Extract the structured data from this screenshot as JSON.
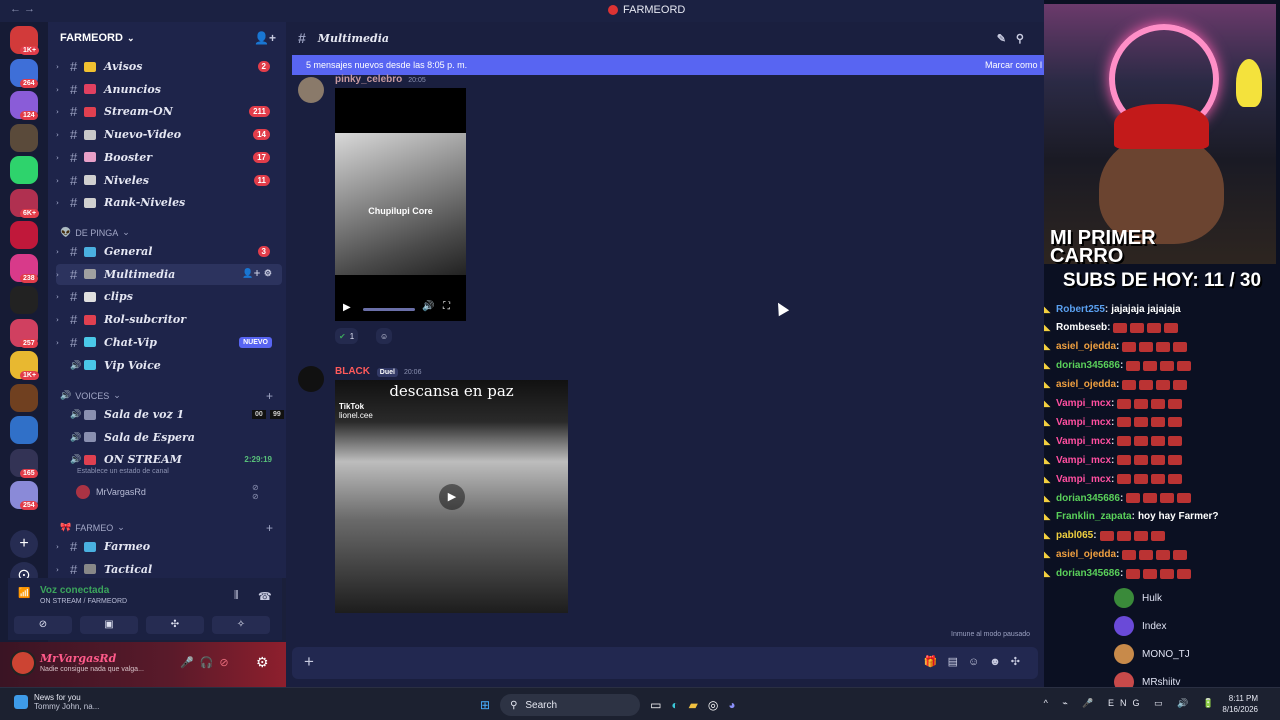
{
  "titlebar": {
    "app_name": "FARMEORD",
    "nav": "← →"
  },
  "rail": {
    "servers": [
      {
        "color": "#d23a3a",
        "badge": "1K+"
      },
      {
        "color": "#3e6fd8",
        "badge": "264"
      },
      {
        "color": "#8a5cd8",
        "badge": "124"
      },
      {
        "color": "#5a4a3a",
        "badge": ""
      },
      {
        "color": "#2ed36c",
        "badge": ""
      },
      {
        "color": "#b03050",
        "badge": "6K+"
      },
      {
        "color": "#c0183a",
        "badge": ""
      },
      {
        "color": "#d83a8a",
        "badge": "238"
      },
      {
        "color": "#222222",
        "badge": ""
      },
      {
        "color": "#d04060",
        "badge": "257"
      },
      {
        "color": "#e8b830",
        "badge": "1K+"
      },
      {
        "color": "#704020",
        "badge": ""
      },
      {
        "color": "#3070c8",
        "badge": ""
      },
      {
        "color": "#333355",
        "badge": "165"
      },
      {
        "color": "#8a8ad8",
        "badge": "254"
      }
    ]
  },
  "server": {
    "name": "FARMEORD",
    "caret": "⌄",
    "invite_icon": "person-add-icon"
  },
  "channels": {
    "top": [
      {
        "name": "Avisos",
        "count": "2",
        "emo": "#f0c030"
      },
      {
        "name": "Anuncios",
        "count": "",
        "emo": "#e04060"
      },
      {
        "name": "Stream-ON",
        "count": "211",
        "emo": "#e04050"
      },
      {
        "name": "Nuevo-Video",
        "count": "14",
        "emo": "#c8c8c8"
      },
      {
        "name": "Booster",
        "count": "17",
        "emo": "#e8a0c8"
      },
      {
        "name": "Niveles",
        "count": "11",
        "emo": "#d0d0d0"
      },
      {
        "name": "Rank-Niveles",
        "count": "",
        "emo": "#d0d0d0"
      }
    ],
    "cat_pinga": "DE PINGA",
    "pinga": [
      {
        "name": "General",
        "count": "3",
        "emo": "#4ab0e0"
      },
      {
        "name": "Multimedia",
        "count": "",
        "emo": "#a0a0a0"
      },
      {
        "name": "clips",
        "count": "",
        "emo": "#e0e0e0"
      },
      {
        "name": "Rol-subcritor",
        "count": "",
        "emo": "#e04050"
      },
      {
        "name": "Chat-Vip",
        "count": "",
        "emo": "#4ac8e8",
        "new": "NUEVO"
      },
      {
        "name": "Vip Voice",
        "count": "",
        "emo": "#4ac8e8"
      }
    ],
    "cat_voices": "VOICES",
    "voices": [
      {
        "name": "Sala de voz 1",
        "emo": "#8a90b0",
        "count_a": "00",
        "count_b": "99"
      },
      {
        "name": "Sala de Espera",
        "emo": "#8a90b0"
      },
      {
        "name": "ON STREAM",
        "emo": "#e04050",
        "timer": "2:29:19"
      }
    ],
    "voice_status": "Establece un estado de canal",
    "voice_user": "MrVargasRd",
    "cat_farmeo": "FARMEO",
    "farmeo": [
      {
        "name": "Farmeo",
        "emo": "#4ab0e0"
      },
      {
        "name": "Tactical",
        "emo": "#888888"
      }
    ]
  },
  "voicebar": {
    "title": "Voz conectada",
    "sub": "ON STREAM / FARMEORD",
    "buttons": [
      "camera-off-icon",
      "screen-share-icon",
      "activities-icon",
      "soundboard-icon"
    ]
  },
  "user": {
    "name": "MrVargasRd",
    "status": "Nadie consigue nada que valga..."
  },
  "chat": {
    "channel": "Multimedia",
    "new_messages": "5 mensajes nuevos desde las 8:05 p. m.",
    "mark_read": "Marcar como l",
    "msg1": {
      "author": "pinky_celebro",
      "time": "20:05",
      "caption": "Chupilupi Core",
      "reaction_count": "1"
    },
    "msg2": {
      "author": "BLACK",
      "tag": "Duel",
      "time": "20:06",
      "video_title": "descansa en paz",
      "tiktok": "TikTok",
      "tiktok_user": "lionel.cee"
    },
    "inmune": "Inmune al modo pausado",
    "composer_plus": "+"
  },
  "stream": {
    "caption_line1": "MI PRIMER",
    "caption_line2": "CARRO",
    "subs": "SUBS DE HOY: 11 / 30",
    "chat": [
      {
        "user": "Robert255",
        "color": "#5aa0f0",
        "msg": "jajajaja jajajaja",
        "emo": false
      },
      {
        "user": "Rombeseb",
        "color": "#ffffff",
        "msg": "",
        "emo": true
      },
      {
        "user": "asiel_ojedda",
        "color": "#f0a040",
        "msg": "",
        "emo": true
      },
      {
        "user": "dorian345686",
        "color": "#5ad05a",
        "msg": "",
        "emo": true
      },
      {
        "user": "asiel_ojedda",
        "color": "#f0a040",
        "msg": "",
        "emo": true
      },
      {
        "user": "Vampi_mcx",
        "color": "#ff4fa0",
        "msg": "",
        "emo": true
      },
      {
        "user": "Vampi_mcx",
        "color": "#ff4fa0",
        "msg": "",
        "emo": true
      },
      {
        "user": "Vampi_mcx",
        "color": "#ff4fa0",
        "msg": "",
        "emo": true
      },
      {
        "user": "Vampi_mcx",
        "color": "#ff4fa0",
        "msg": "",
        "emo": true
      },
      {
        "user": "Vampi_mcx",
        "color": "#ff4fa0",
        "msg": "",
        "emo": true
      },
      {
        "user": "dorian345686",
        "color": "#5ad05a",
        "msg": "",
        "emo": true
      },
      {
        "user": "Franklin_zapata",
        "color": "#5ad05a",
        "msg": "hoy hay Farmer?",
        "emo": false
      },
      {
        "user": "pabl065",
        "color": "#f0d040",
        "msg": "",
        "emo": true
      },
      {
        "user": "asiel_ojedda",
        "color": "#f0a040",
        "msg": "",
        "emo": true
      },
      {
        "user": "dorian345686",
        "color": "#5ad05a",
        "msg": "",
        "emo": true
      }
    ],
    "members": [
      {
        "name": "Hulk",
        "sub": "",
        "color": "#3a8a3a"
      },
      {
        "name": "Index",
        "sub": "",
        "color": "#6a4ad8"
      },
      {
        "name": "MONO_TJ",
        "sub": "",
        "color": "#c88a4a"
      },
      {
        "name": "MRshiitv",
        "sub": "Fireworks Mania",
        "color": "#c84a4a"
      }
    ]
  },
  "taskbar": {
    "news_title": "News for you",
    "news_sub": "Tommy John, na...",
    "search": "Search",
    "lang": "ENG",
    "time": "8:11 PM",
    "date": "8/16/2026"
  }
}
